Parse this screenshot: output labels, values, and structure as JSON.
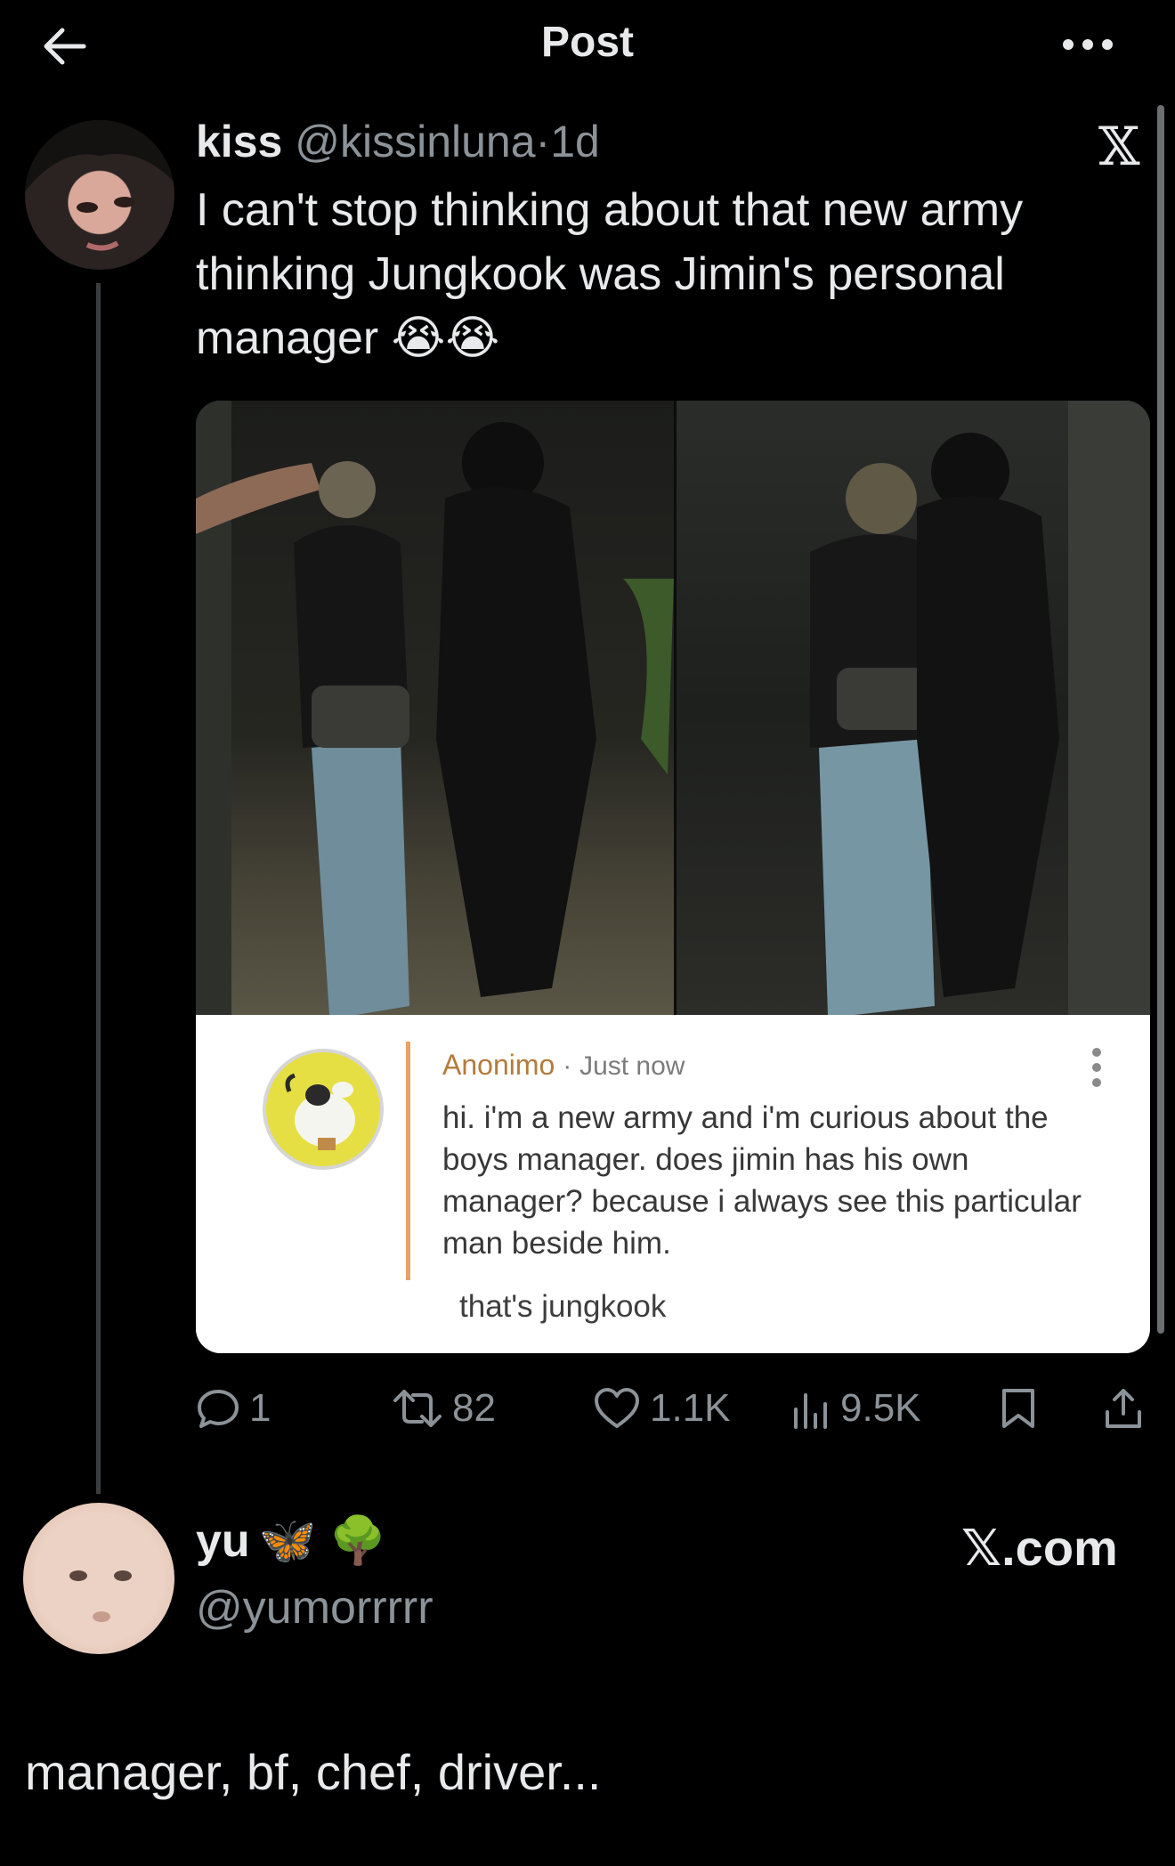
{
  "header": {
    "title": "Post",
    "back_icon": "arrow-left-icon",
    "more_icon": "more-horizontal-icon"
  },
  "tweet": {
    "display_name": "kiss",
    "handle": "@kissinluna",
    "separator": "·",
    "time": "1d",
    "platform_badge": "𝕏",
    "text": "I can't stop thinking about that new army thinking Jungkook was Jimin's personal manager 😭😭",
    "embedded_card": {
      "author": "Anonimo",
      "separator": "·",
      "time": "Just now",
      "body": "hi. i'm a new army and i'm curious about the boys manager. does jimin has his own manager? because i always see this particular man beside him.",
      "reply": "that's jungkook"
    },
    "actions": {
      "replies": "1",
      "reposts": "82",
      "likes": "1.1K",
      "views": "9.5K"
    }
  },
  "reply_tweet": {
    "display_name": "yu",
    "name_emojis": "🦋 🌳",
    "handle": "@yumorrrrr",
    "source_badge": "𝕏.com",
    "text": "manager, bf, chef, driver..."
  },
  "colors": {
    "background": "#000000",
    "primary_text": "#e7e9ea",
    "secondary_text": "#8b9298",
    "card_author": "#b57b3c",
    "card_bar": "#e5a26a"
  }
}
